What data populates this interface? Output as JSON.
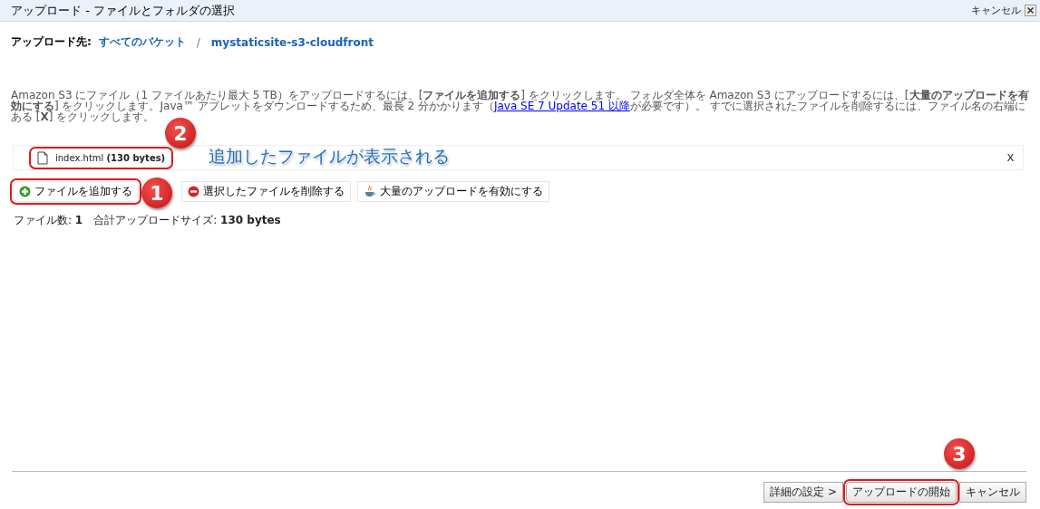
{
  "window": {
    "title": "アップロード - ファイルとフォルダの選択",
    "close_label": "キャンセル"
  },
  "breadcrumb": {
    "label": "アップロード先:",
    "items": [
      "すべてのバケット",
      "mystaticsite-s3-cloudfront"
    ],
    "separator": "/"
  },
  "instructions": {
    "before": "Amazon S3 にファイル（1 ファイルあたり最大 5 TB）をアップロードするには、[**ファイルを追加する**] をクリックします。 フォルダ全体を Amazon S3 にアップロードするには、[**大量のアップロードを有効にする**] をクリックします。Java™ アプレットをダウンロードするため、最長 2 分かかります（",
    "link": "Java SE 7 Update 51 以降",
    "after": "が必要です）。 すでに選択されたファイルを削除するには、ファイル名の右端にある [**X**] をクリックします。"
  },
  "files": [
    {
      "name": "index.html",
      "size": "(130 bytes)",
      "remove": "X",
      "highlighted": true
    }
  ],
  "actions": [
    {
      "label": "ファイルを追加する",
      "kind": "add",
      "highlighted": true
    },
    {
      "label": "選択したファイルを削除する",
      "kind": "remove",
      "highlighted": false
    },
    {
      "label": "大量のアップロードを有効にする",
      "kind": "java",
      "highlighted": false
    }
  ],
  "summary": {
    "count_label": "ファイル数:",
    "count": "1",
    "size_label": "合計アップロードサイズ:",
    "size": "130 bytes"
  },
  "footer_buttons": [
    {
      "label": "詳細の設定 >",
      "highlighted": false
    },
    {
      "label": "アップロードの開始",
      "highlighted": true
    },
    {
      "label": "キャンセル",
      "highlighted": false
    }
  ],
  "annotations": [
    {
      "number": "2",
      "caption": "追加したファイルが表示される"
    },
    {
      "number": "1"
    },
    {
      "number": "3"
    }
  ]
}
